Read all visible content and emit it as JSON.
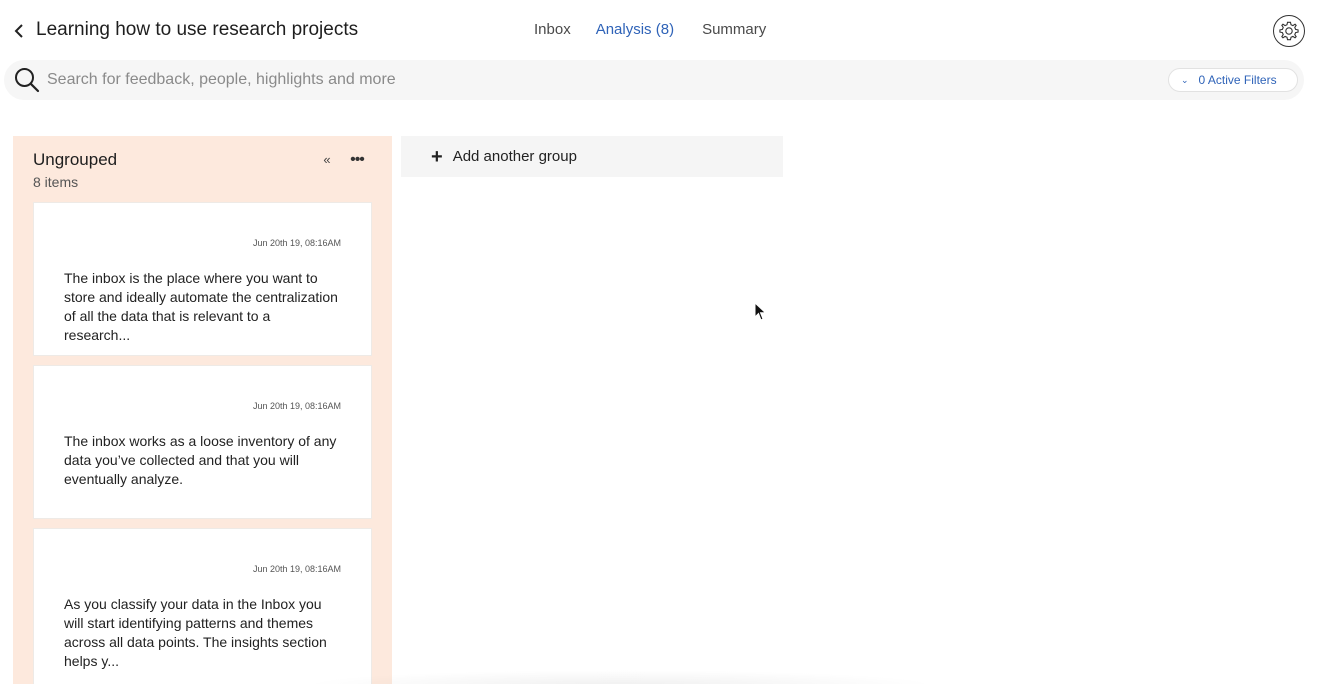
{
  "header": {
    "title": "Learning how to use research projects",
    "tabs": [
      {
        "label": "Inbox",
        "active": false
      },
      {
        "label": "Analysis (8)",
        "active": true
      },
      {
        "label": "Summary",
        "active": false
      }
    ],
    "back_icon": "chevron-left-icon",
    "settings_icon": "gear-icon"
  },
  "search": {
    "placeholder": "Search for feedback, people, highlights and more",
    "value": "",
    "filters_label": "0 Active Filters"
  },
  "group": {
    "name": "Ungrouped",
    "count_label": "8 items",
    "cards": [
      {
        "timestamp": "Jun 20th 19, 08:16AM",
        "text": "The inbox is the place where you want to store and ideally automate the centralization of all the data that is relevant to a research..."
      },
      {
        "timestamp": "Jun 20th 19, 08:16AM",
        "text": "The inbox works as a loose inventory of any data you’ve collected and that you will eventually analyze."
      },
      {
        "timestamp": "Jun 20th 19, 08:16AM",
        "text": "As you classify your data in the Inbox you will start identifying patterns and themes across all data points. The insights section helps y..."
      }
    ]
  },
  "add_group": {
    "label": "Add another group"
  },
  "colors": {
    "accent": "#2f63b8",
    "group_bg": "#fde9dd",
    "search_bg": "#f6f6f6"
  }
}
